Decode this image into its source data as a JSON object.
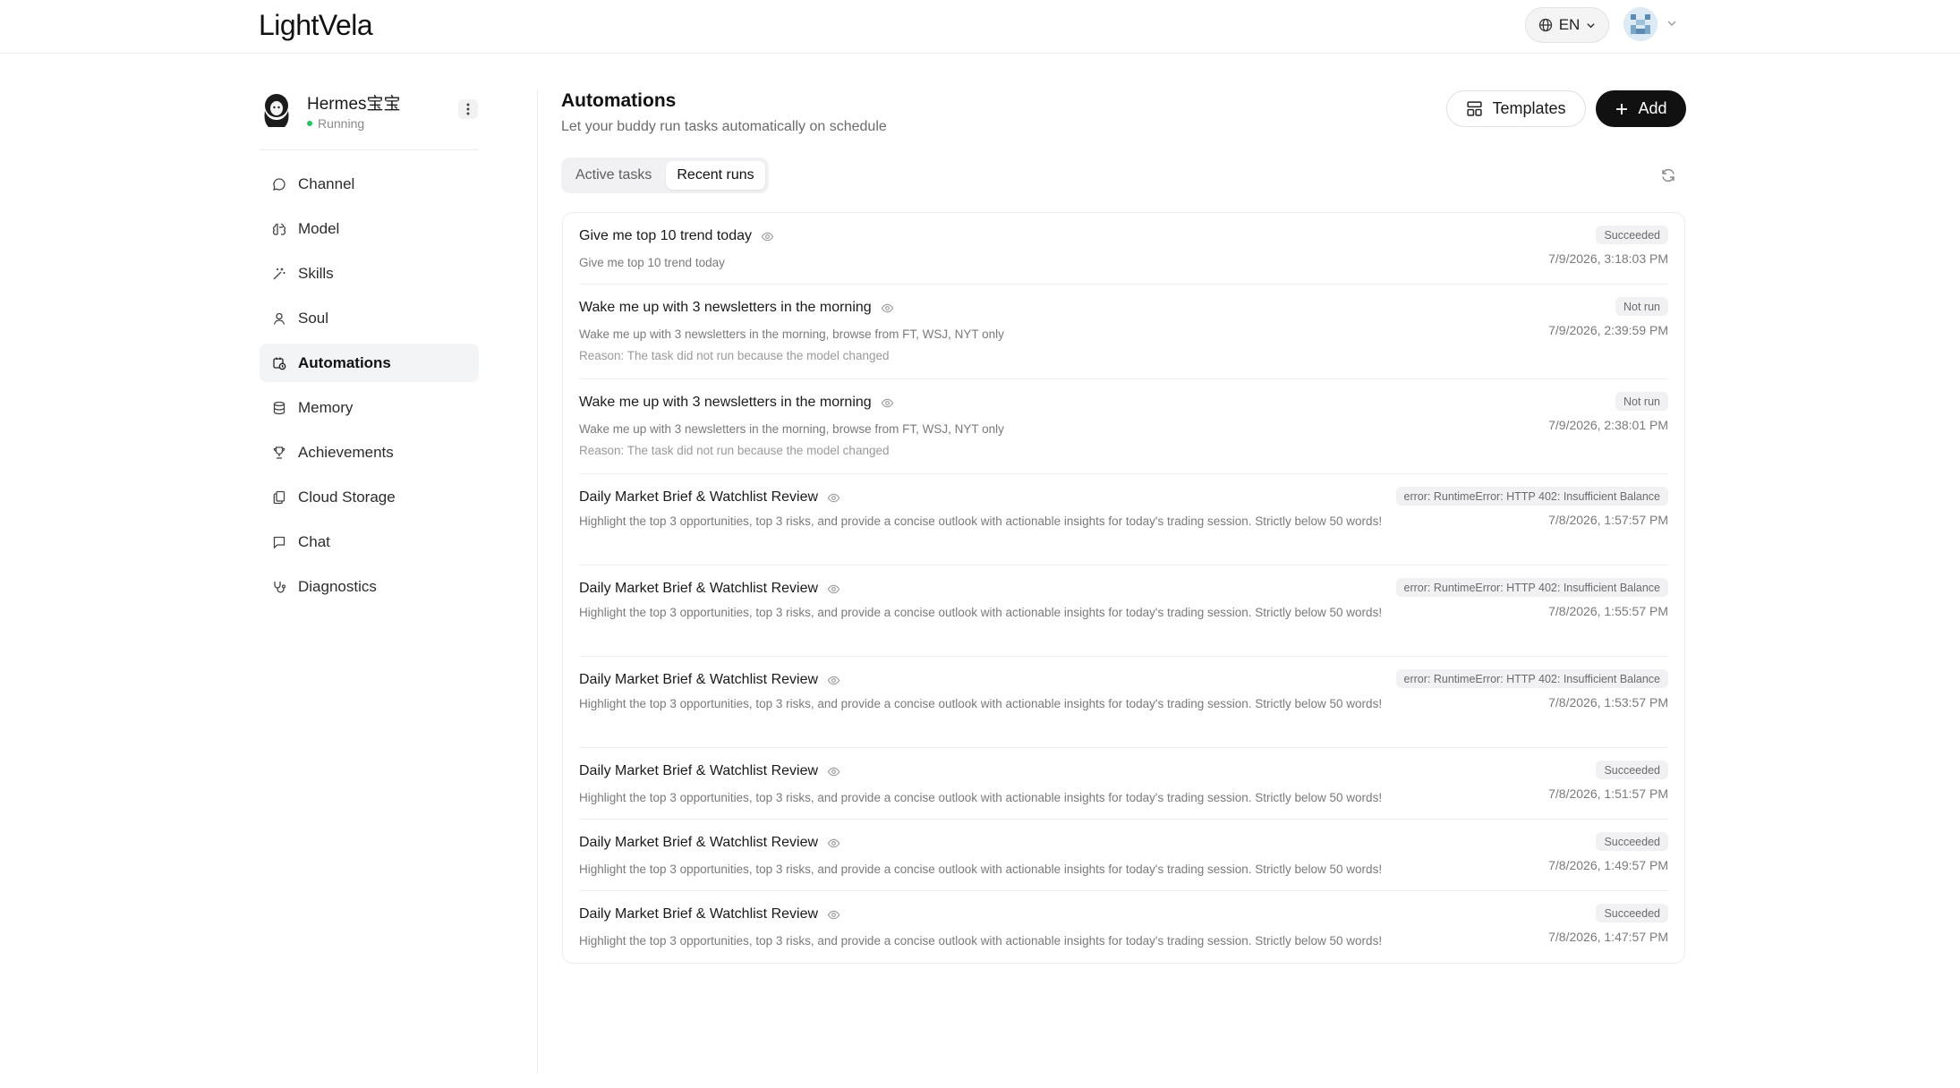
{
  "header": {
    "logo": "LightVela",
    "language": "EN"
  },
  "agent": {
    "name": "Hermes宝宝",
    "status": "Running",
    "status_color": "#22c55e"
  },
  "sidebar": {
    "items": [
      {
        "label": "Channel",
        "icon": "chat-bubble-icon"
      },
      {
        "label": "Model",
        "icon": "brain-icon"
      },
      {
        "label": "Skills",
        "icon": "magic-wand-icon"
      },
      {
        "label": "Soul",
        "icon": "user-icon"
      },
      {
        "label": "Automations",
        "icon": "calendar-clock-icon",
        "active": true
      },
      {
        "label": "Memory",
        "icon": "database-icon"
      },
      {
        "label": "Achievements",
        "icon": "trophy-icon"
      },
      {
        "label": "Cloud Storage",
        "icon": "files-icon"
      },
      {
        "label": "Chat",
        "icon": "message-square-icon"
      },
      {
        "label": "Diagnostics",
        "icon": "stethoscope-icon"
      }
    ]
  },
  "main": {
    "title": "Automations",
    "subtitle": "Let your buddy run tasks automatically on schedule",
    "templates_label": "Templates",
    "add_label": "Add",
    "tabs": [
      {
        "label": "Active tasks",
        "active": false
      },
      {
        "label": "Recent runs",
        "active": true
      }
    ]
  },
  "runs": [
    {
      "title": "Give me top 10 trend today",
      "desc": "Give me top 10 trend today",
      "reason": "",
      "status": "Succeeded",
      "time": "7/9/2026, 3:18:03 PM"
    },
    {
      "title": "Wake me up with 3 newsletters in the morning",
      "desc": "Wake me up with 3 newsletters in the morning, browse from FT, WSJ, NYT only",
      "reason": "Reason: The task did not run because the model changed",
      "status": "Not run",
      "time": "7/9/2026, 2:39:59 PM"
    },
    {
      "title": "Wake me up with 3 newsletters in the morning",
      "desc": "Wake me up with 3 newsletters in the morning, browse from FT, WSJ, NYT only",
      "reason": "Reason: The task did not run because the model changed",
      "status": "Not run",
      "time": "7/9/2026, 2:38:01 PM"
    },
    {
      "title": "Daily Market Brief & Watchlist Review",
      "desc": "Highlight the top 3 opportunities, top 3 risks, and provide a concise outlook with actionable insights for today's trading session. Strictly below 50 words!",
      "reason": "",
      "status": "error: RuntimeError: HTTP 402: Insufficient Balance",
      "time": "7/8/2026, 1:57:57 PM"
    },
    {
      "title": "Daily Market Brief & Watchlist Review",
      "desc": "Highlight the top 3 opportunities, top 3 risks, and provide a concise outlook with actionable insights for today's trading session. Strictly below 50 words!",
      "reason": "",
      "status": "error: RuntimeError: HTTP 402: Insufficient Balance",
      "time": "7/8/2026, 1:55:57 PM"
    },
    {
      "title": "Daily Market Brief & Watchlist Review",
      "desc": "Highlight the top 3 opportunities, top 3 risks, and provide a concise outlook with actionable insights for today's trading session. Strictly below 50 words!",
      "reason": "",
      "status": "error: RuntimeError: HTTP 402: Insufficient Balance",
      "time": "7/8/2026, 1:53:57 PM"
    },
    {
      "title": "Daily Market Brief & Watchlist Review",
      "desc": "Highlight the top 3 opportunities, top 3 risks, and provide a concise outlook with actionable insights for today's trading session. Strictly below 50 words!",
      "reason": "",
      "status": "Succeeded",
      "time": "7/8/2026, 1:51:57 PM"
    },
    {
      "title": "Daily Market Brief & Watchlist Review",
      "desc": "Highlight the top 3 opportunities, top 3 risks, and provide a concise outlook with actionable insights for today's trading session. Strictly below 50 words!",
      "reason": "",
      "status": "Succeeded",
      "time": "7/8/2026, 1:49:57 PM"
    },
    {
      "title": "Daily Market Brief & Watchlist Review",
      "desc": "Highlight the top 3 opportunities, top 3 risks, and provide a concise outlook with actionable insights for today's trading session. Strictly below 50 words!",
      "reason": "",
      "status": "Succeeded",
      "time": "7/8/2026, 1:47:57 PM"
    }
  ]
}
